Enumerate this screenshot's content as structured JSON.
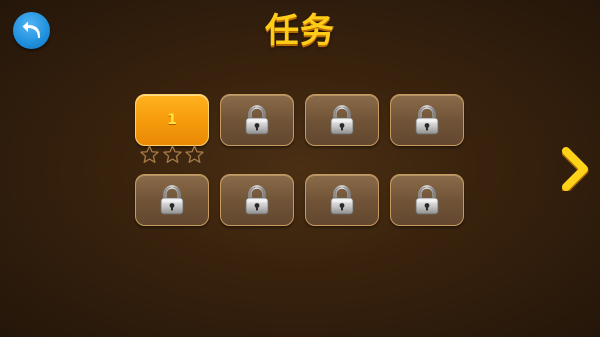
{
  "header": {
    "title": "任务",
    "back_icon": "back-arrow-icon"
  },
  "levels": [
    {
      "number": "1",
      "state": "unlocked",
      "stars_earned": 0,
      "stars_total": 3
    },
    {
      "state": "locked",
      "icon": "padlock-icon"
    },
    {
      "state": "locked",
      "icon": "padlock-icon"
    },
    {
      "state": "locked",
      "icon": "padlock-icon"
    },
    {
      "state": "locked",
      "icon": "padlock-icon"
    },
    {
      "state": "locked",
      "icon": "padlock-icon"
    },
    {
      "state": "locked",
      "icon": "padlock-icon"
    },
    {
      "state": "locked",
      "icon": "padlock-icon"
    }
  ],
  "navigation": {
    "next_icon": "chevron-right-icon"
  },
  "colors": {
    "title": "#ffcc18",
    "back_button": "#1f8fdc",
    "unlocked_tile": "#f59a0c",
    "locked_tile": "#6f5236",
    "next_arrow": "#ffd21a",
    "background": "#3a230d"
  }
}
